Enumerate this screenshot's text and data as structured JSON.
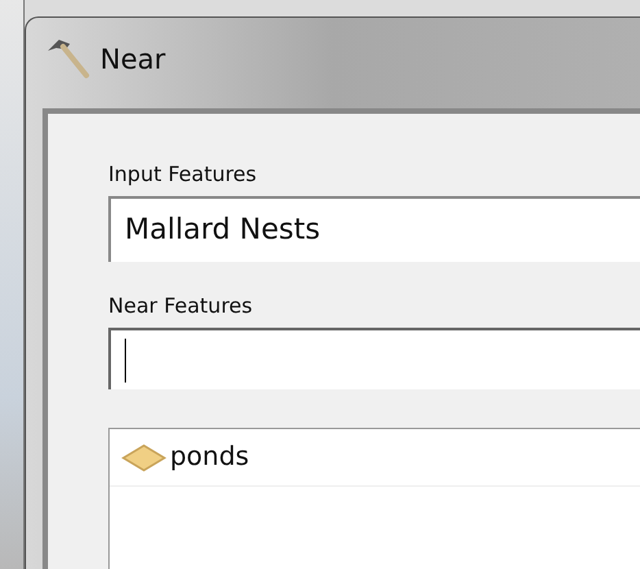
{
  "window": {
    "title": "Near"
  },
  "input_features": {
    "label": "Input Features",
    "value": "Mallard Nests"
  },
  "near_features": {
    "label": "Near Features",
    "focused": true,
    "items": [
      {
        "label": "ponds"
      }
    ]
  }
}
